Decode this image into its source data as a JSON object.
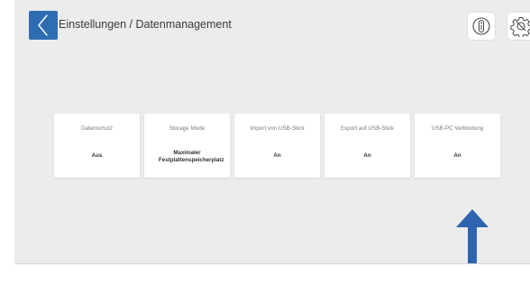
{
  "header": {
    "title": "Einstellungen / Datenmanagement",
    "back_icon": "chevron-left-icon",
    "info_icon": "info-icon",
    "settings_icon": "gear-icon"
  },
  "tiles": [
    {
      "label": "Datenschutz",
      "value": "Aus"
    },
    {
      "label": "Storage Mode",
      "value": "Maximaler Festplattenspeicherplatz"
    },
    {
      "label": "Import von USB-Stick",
      "value": "An"
    },
    {
      "label": "Export auf USB-Stick",
      "value": "An"
    },
    {
      "label": "USB-PC Verbindung",
      "value": "An"
    }
  ],
  "colors": {
    "accent": "#2f6db3",
    "background": "#ececec",
    "tile": "#ffffff",
    "annotation_arrow": "#2f65b0"
  }
}
